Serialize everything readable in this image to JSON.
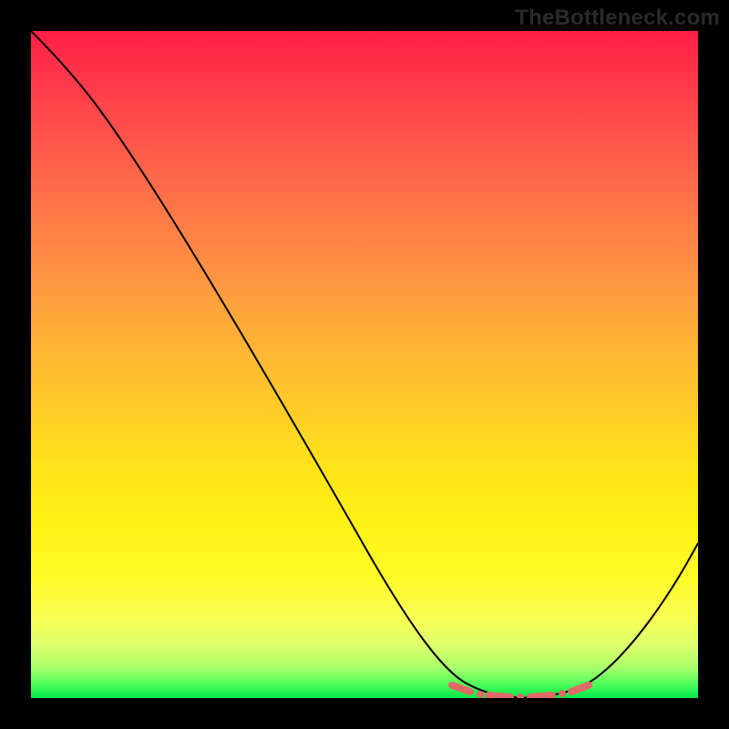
{
  "watermark": "TheBottleneck.com",
  "chart_data": {
    "type": "line",
    "title": "",
    "xlabel": "",
    "ylabel": "",
    "xlim": [
      0,
      100
    ],
    "ylim": [
      0,
      100
    ],
    "background_gradient": {
      "top": "#ff1f47",
      "middle": "#ffe41a",
      "bottom": "#00e84a"
    },
    "series": [
      {
        "name": "curve",
        "color": "#000000",
        "x": [
          0,
          5,
          10,
          15,
          20,
          25,
          30,
          35,
          40,
          45,
          50,
          55,
          60,
          63,
          66,
          70,
          74,
          78,
          82,
          86,
          90,
          94,
          100
        ],
        "y": [
          100,
          96,
          92,
          87,
          81,
          73,
          64,
          55,
          46,
          37,
          28,
          19,
          11,
          6,
          3,
          1,
          0,
          0,
          1,
          4,
          9,
          16,
          28
        ]
      }
    ],
    "highlight": {
      "description": "dashed coral marker near curve minimum",
      "color": "#e06a66",
      "x_range": [
        63,
        84
      ],
      "y_approx": 1
    }
  }
}
